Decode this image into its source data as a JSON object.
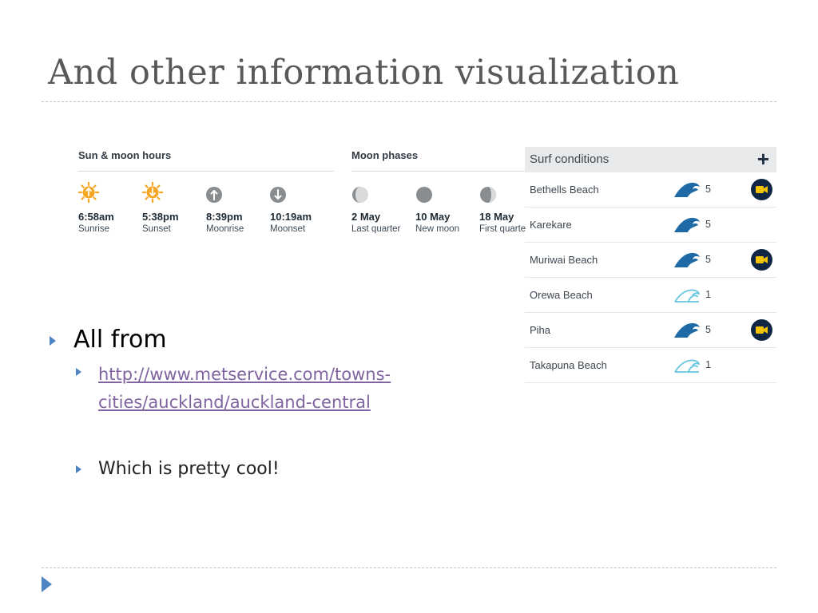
{
  "slide": {
    "title": "And other information visualization"
  },
  "sun_moon": {
    "heading": "Sun & moon hours",
    "items": [
      {
        "time": "6:58am",
        "label": "Sunrise",
        "icon": "sunrise-icon"
      },
      {
        "time": "5:38pm",
        "label": "Sunset",
        "icon": "sunset-icon"
      },
      {
        "time": "8:39pm",
        "label": "Moonrise",
        "icon": "moonrise-icon"
      },
      {
        "time": "10:19am",
        "label": "Moonset",
        "icon": "moonset-icon"
      }
    ]
  },
  "moon_phases": {
    "heading": "Moon phases",
    "items": [
      {
        "date": "2 May",
        "label": "Last quarter",
        "icon": "last-quarter-moon-icon"
      },
      {
        "date": "10 May",
        "label": "New moon",
        "icon": "new-moon-icon"
      },
      {
        "date": "18 May",
        "label": "First quarter",
        "icon": "first-quarter-moon-icon"
      }
    ]
  },
  "surf": {
    "heading": "Surf conditions",
    "expand_label": "+",
    "rows": [
      {
        "name": "Bethells Beach",
        "rating": "5",
        "camera": true
      },
      {
        "name": "Karekare",
        "rating": "5",
        "camera": false
      },
      {
        "name": "Muriwai Beach",
        "rating": "5",
        "camera": true
      },
      {
        "name": "Orewa Beach",
        "rating": "1",
        "camera": false
      },
      {
        "name": "Piha",
        "rating": "5",
        "camera": true
      },
      {
        "name": "Takapuna Beach",
        "rating": "1",
        "camera": false
      }
    ]
  },
  "bullets": {
    "main": "All from",
    "link_line1": "http://www.metservice.com/towns-",
    "link_line2": "cities/auckland/auckland-central",
    "note": "Which is pretty cool!"
  },
  "colors": {
    "accent": "#4e84c4",
    "link": "#8064a2",
    "wave_big": "#1e6aa6",
    "wave_small": "#68c5e0",
    "camera_bg": "#0f2744",
    "sun": "#f5a623"
  }
}
